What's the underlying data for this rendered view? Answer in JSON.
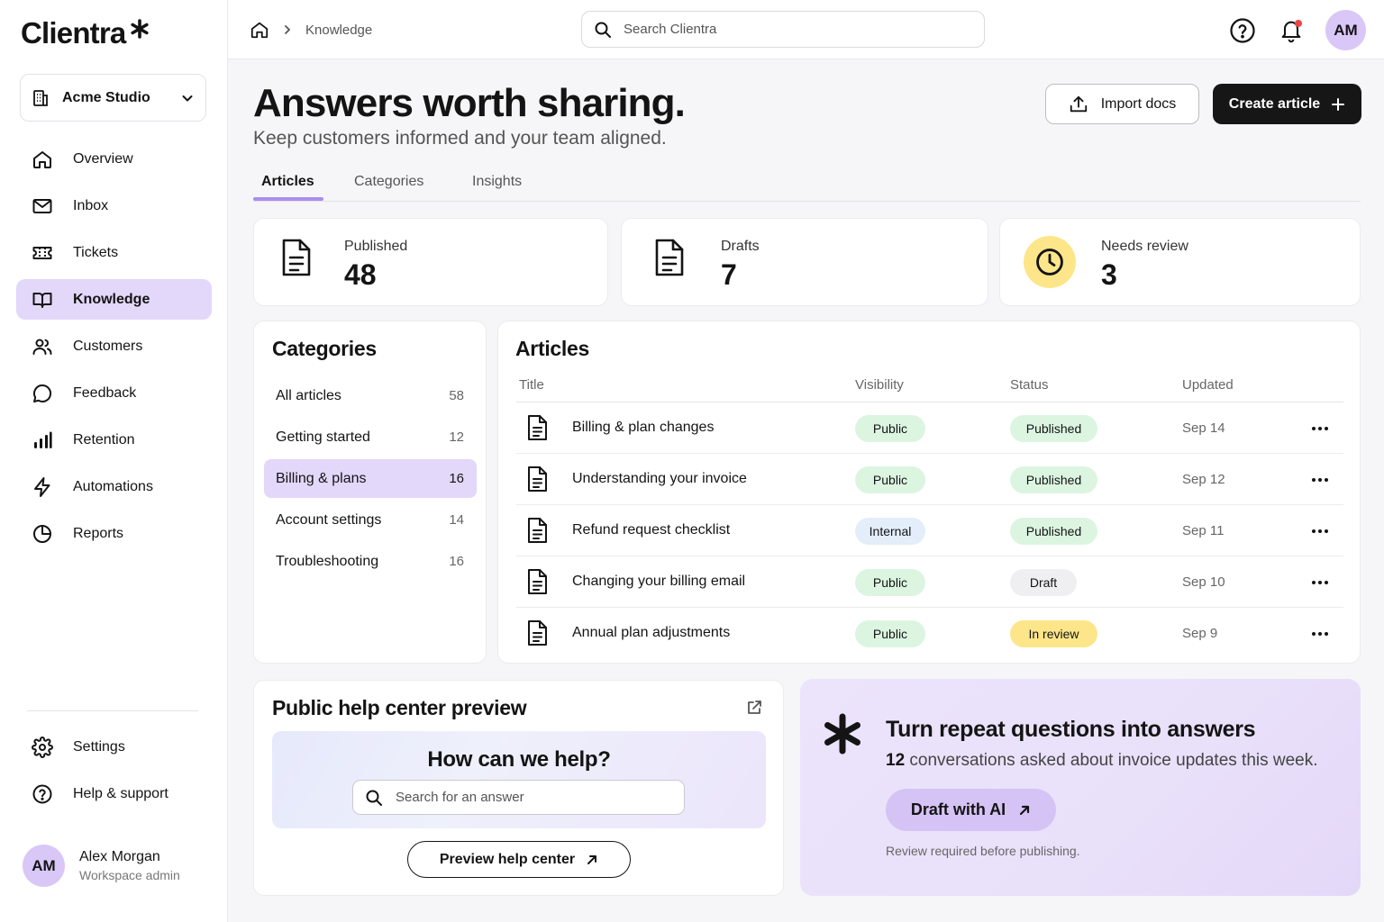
{
  "app": {
    "name": "Clientra"
  },
  "workspace": {
    "name": "Acme Studio"
  },
  "sidebar": {
    "items": [
      {
        "label": "Overview",
        "icon": "home-icon"
      },
      {
        "label": "Inbox",
        "icon": "mail-icon"
      },
      {
        "label": "Tickets",
        "icon": "ticket-icon"
      },
      {
        "label": "Knowledge",
        "icon": "book-icon",
        "active": true
      },
      {
        "label": "Customers",
        "icon": "users-icon"
      },
      {
        "label": "Feedback",
        "icon": "chat-bubble-icon"
      },
      {
        "label": "Retention",
        "icon": "bar-chart-icon"
      },
      {
        "label": "Automations",
        "icon": "lightning-icon"
      },
      {
        "label": "Reports",
        "icon": "pie-chart-icon"
      }
    ],
    "bottom": [
      {
        "label": "Settings",
        "icon": "gear-icon"
      },
      {
        "label": "Help & support",
        "icon": "help-circle-icon"
      }
    ],
    "user": {
      "initials": "AM",
      "name": "Alex Morgan",
      "role": "Workspace admin"
    }
  },
  "topbar": {
    "breadcrumb": "Knowledge",
    "search_placeholder": "Search Clientra",
    "avatar_initials": "AM"
  },
  "header": {
    "title": "Answers worth sharing.",
    "subtitle": "Keep customers informed and your team aligned.",
    "import_label": "Import docs",
    "create_label": "Create article"
  },
  "tabs": [
    {
      "label": "Articles",
      "active": true
    },
    {
      "label": "Categories"
    },
    {
      "label": "Insights"
    }
  ],
  "stats": [
    {
      "label": "Published",
      "value": "48"
    },
    {
      "label": "Drafts",
      "value": "7"
    },
    {
      "label": "Needs review",
      "value": "3"
    }
  ],
  "categories": {
    "title": "Categories",
    "items": [
      {
        "label": "All articles",
        "count": "58"
      },
      {
        "label": "Getting started",
        "count": "12"
      },
      {
        "label": "Billing & plans",
        "count": "16",
        "active": true
      },
      {
        "label": "Account settings",
        "count": "14"
      },
      {
        "label": "Troubleshooting",
        "count": "16"
      }
    ]
  },
  "articles": {
    "title": "Articles",
    "columns": [
      "Title",
      "Visibility",
      "Status",
      "Updated"
    ],
    "rows": [
      {
        "title": "Billing & plan changes",
        "visibility": "Public",
        "status": "Published",
        "updated": "Sep 14"
      },
      {
        "title": "Understanding your invoice",
        "visibility": "Public",
        "status": "Published",
        "updated": "Sep 12"
      },
      {
        "title": "Refund request checklist",
        "visibility": "Internal",
        "status": "Published",
        "updated": "Sep 11"
      },
      {
        "title": "Changing your billing email",
        "visibility": "Public",
        "status": "Draft",
        "updated": "Sep 10"
      },
      {
        "title": "Annual plan adjustments",
        "visibility": "Public",
        "status": "In review",
        "updated": "Sep 9"
      }
    ]
  },
  "preview": {
    "title": "Public help center preview",
    "question": "How can we help?",
    "search_placeholder": "Search for an answer",
    "button_label": "Preview help center"
  },
  "ai": {
    "title": "Turn repeat questions into answers",
    "count": "12",
    "subtitle_rest": "conversations asked about invoice updates this week.",
    "button_label": "Draft with AI",
    "note": "Review required before publishing."
  },
  "colors": {
    "accent": "#a98ef0",
    "active_bg": "#e3d7fa",
    "dark": "#161616",
    "public_pill": "#dcf5e1",
    "internal_pill": "#e3eefa",
    "review_pill": "#fde68a",
    "draft_pill": "#efeff2"
  }
}
